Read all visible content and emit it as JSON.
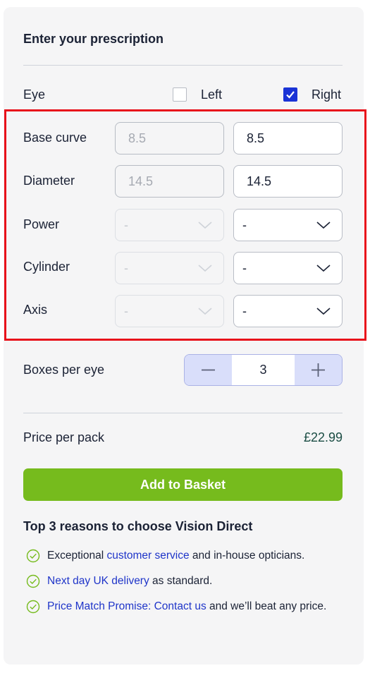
{
  "title": "Enter your prescription",
  "eye": {
    "label": "Eye",
    "left_label": "Left",
    "right_label": "Right",
    "left_checked": false,
    "right_checked": true
  },
  "fields": {
    "base_curve": {
      "label": "Base curve",
      "left": "8.5",
      "right": "8.5"
    },
    "diameter": {
      "label": "Diameter",
      "left": "14.5",
      "right": "14.5"
    },
    "power": {
      "label": "Power",
      "left": "-",
      "right": "-"
    },
    "cylinder": {
      "label": "Cylinder",
      "left": "-",
      "right": "-"
    },
    "axis": {
      "label": "Axis",
      "left": "-",
      "right": "-"
    }
  },
  "boxes": {
    "label": "Boxes per eye",
    "minus": "−",
    "value": "3",
    "plus": "+"
  },
  "price": {
    "label": "Price per pack",
    "value": "£22.99"
  },
  "cta": {
    "label": "Add to Basket"
  },
  "reasons": {
    "title": "Top 3 reasons to choose Vision Direct",
    "r1": {
      "pre": "Exceptional ",
      "link": "customer service",
      "post": " and in-house opticians."
    },
    "r2": {
      "link": "Next day UK delivery",
      "post": " as standard."
    },
    "r3": {
      "link": "Price Match Promise: Contact us",
      "post": " and we’ll beat any price."
    }
  },
  "colors": {
    "accent_blue": "#1a33d6",
    "cta_green": "#76bb1d",
    "highlight_red": "#e8121b",
    "price_text": "#1b4d44"
  }
}
